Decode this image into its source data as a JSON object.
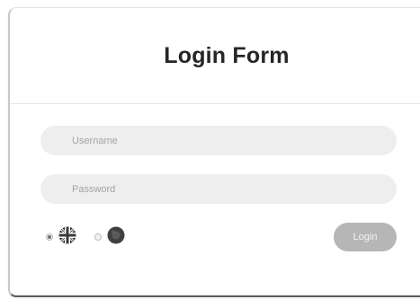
{
  "form": {
    "title": "Login Form",
    "username_placeholder": "Username",
    "password_placeholder": "Password",
    "login_label": "Login"
  },
  "languages": [
    {
      "icon": "uk-flag-icon",
      "selected": true
    },
    {
      "icon": "red-circle-flag-icon",
      "selected": false
    }
  ],
  "colors": {
    "field_background": "#eeeeee",
    "button_background": "#b6b6b6",
    "title": "#262626"
  }
}
